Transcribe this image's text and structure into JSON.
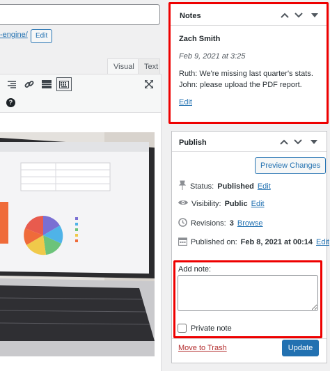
{
  "editor": {
    "permalink_text": "-engine/",
    "edit_label": "Edit",
    "tabs": {
      "visual": "Visual",
      "text": "Text"
    },
    "help_glyph": "?"
  },
  "notes": {
    "title": "Notes",
    "author": "Zach Smith",
    "date": "Feb 9, 2021 at 3:25",
    "line1": "Ruth: We're missing last quarter's stats.",
    "line2": "John: please upload the PDF report.",
    "edit_label": "Edit"
  },
  "publish": {
    "title": "Publish",
    "preview_label": "Preview Changes",
    "status_label": "Status:",
    "status_value": "Published",
    "status_edit": "Edit",
    "visibility_label": "Visibility:",
    "visibility_value": "Public",
    "visibility_edit": "Edit",
    "revisions_label": "Revisions:",
    "revisions_value": "3",
    "revisions_browse": "Browse",
    "published_label": "Published on:",
    "published_value": "Feb 8, 2021 at 00:14",
    "published_edit": "Edit",
    "add_note_label": "Add note:",
    "add_note_value": "",
    "private_note_label": "Private note",
    "trash_label": "Move to Trash",
    "update_label": "Update"
  },
  "colors": {
    "highlight": "#e00000",
    "link": "#2271b1",
    "primary": "#2271b1"
  },
  "icons": [
    "chevron-up-icon",
    "chevron-down-icon",
    "caret-down-icon",
    "pin-icon",
    "eye-icon",
    "history-icon",
    "calendar-icon",
    "align-icon",
    "link-icon",
    "readmore-icon",
    "keyboard-icon",
    "fullscreen-icon",
    "help-icon"
  ]
}
